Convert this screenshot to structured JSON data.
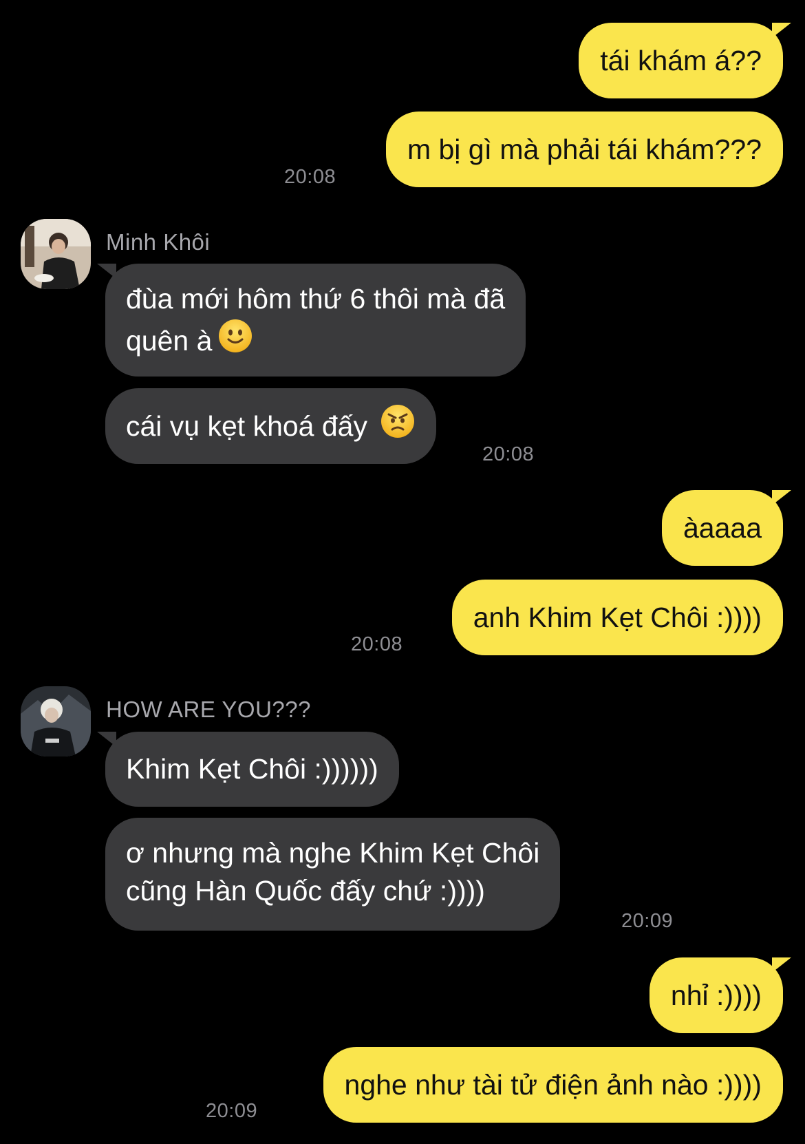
{
  "colors": {
    "background": "#000000",
    "outgoing_bubble": "#fae54d",
    "incoming_bubble": "#3a3a3c",
    "timestamp": "#8e8e93"
  },
  "messages": {
    "m1": {
      "text": "tái khám á??"
    },
    "m2": {
      "text": "m bị gì mà phải tái khám???"
    },
    "t1": "20:08",
    "sender1": {
      "name": "Minh Khôi"
    },
    "m3": {
      "line1": "đùa mới hôm thứ 6 thôi mà đã",
      "line2": "quên à",
      "emoji": "slightly-smiling-face-icon"
    },
    "m4": {
      "text": "cái vụ kẹt khoá đấy",
      "emoji": "angry-face-icon"
    },
    "t2": "20:08",
    "m5": {
      "text": "àaaaa"
    },
    "m6": {
      "text": "anh Khim Kẹt Chôi :))))"
    },
    "t3": "20:08",
    "sender2": {
      "name": "HOW ARE YOU???"
    },
    "m7": {
      "text": "Khim Kẹt Chôi :))))))"
    },
    "m8": {
      "line1": "ơ nhưng mà nghe Khim Kẹt Chôi",
      "line2": "cũng Hàn Quốc đấy chứ :))))"
    },
    "t4": "20:09",
    "m9": {
      "text": "nhỉ :))))"
    },
    "m10": {
      "text": "nghe như tài tử điện ảnh nào :))))"
    },
    "t5": "20:09"
  }
}
